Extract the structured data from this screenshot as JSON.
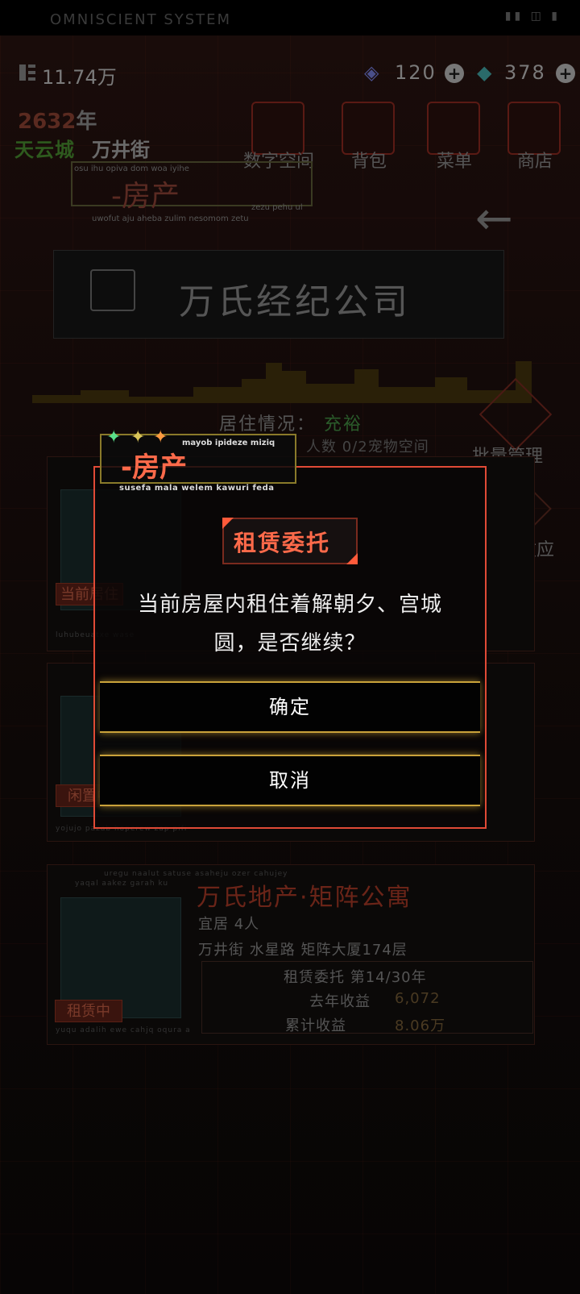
{
  "status_bar": {
    "title": "OMNISCIENT SYSTEM"
  },
  "currency": {
    "money": "11.74万",
    "gem_blue": "120",
    "gem_teal": "378"
  },
  "location": {
    "year_number": "2632",
    "year_unit": "年",
    "city": "天云城",
    "street": "万井街"
  },
  "top_nav": {
    "digital_space": "数字空间",
    "bag": "背包",
    "menu": "菜单",
    "shop": "商店"
  },
  "page_header": {
    "title": "-房产",
    "sub1": "osu ihu opiva dom woa iyihe",
    "sub2": "uwofut aju aheba zulim nesomom zetu",
    "sub3": "zezu pehu ul"
  },
  "company": {
    "name": "万氏经纪公司"
  },
  "living": {
    "label": "居住情况：",
    "value": "充裕",
    "pets": "人数 0/2宠物空间"
  },
  "side_buttons": {
    "batch": "批量管理",
    "effect": "地产效应"
  },
  "cards": {
    "card1_tag": "当前居住",
    "card2_tag": "闲置中",
    "card3": {
      "name": "万氏地产·矩阵公寓",
      "population": "宜居 4人",
      "address": "万井街 水星路 矩阵大厦174层",
      "lease": "租赁委托 第14/30年",
      "last_year_label": "去年收益",
      "last_year_value": "6,072",
      "total_label": "累计收益",
      "total_value": "8.06万",
      "tag": "租赁中",
      "caption_top": "uregu naalut satuse asaheju ozer cahujey",
      "caption_left": "yaqal aakez garah ku",
      "caption_bottom": "yuqu adalih ewe cahjq oqura a"
    },
    "card2_caption": "yojujo pazab hoperew zap pifi",
    "card1_caption": "luhubeuatxe wase"
  },
  "modal": {
    "header_title": "-房产",
    "header_top": "mayob ipideze miziq",
    "header_sub": "susefa mala welem kawuri feda",
    "badge": "租赁委托",
    "message": "当前房屋内租住着解朝夕、宫城圆，是否继续？",
    "confirm": "确定",
    "cancel": "取消"
  },
  "colors": {
    "accent_red": "#e04a36",
    "gold": "#c9a23a",
    "badge_text": "#ff6a4a"
  }
}
